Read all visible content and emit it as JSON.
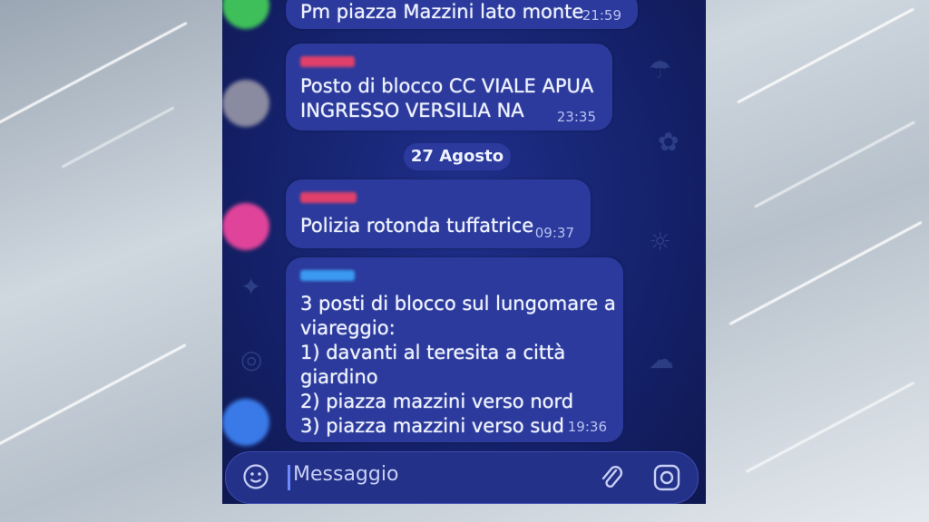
{
  "messages": [
    {
      "text": "Pm piazza Mazzini lato monte",
      "time": "21:59"
    },
    {
      "text": "Posto di blocco CC VIALE APUA\nINGRESSO VERSILIA NA",
      "time": "23:35"
    },
    {
      "text": "Polizia rotonda tuffatrice",
      "time": "09:37"
    },
    {
      "text": "3 posti di blocco sul lungomare a\nviareggio:\n1) davanti al teresita a città\ngiardino\n2) piazza mazzini verso nord\n3) piazza mazzini verso sud",
      "time": "19:36"
    }
  ],
  "date_separator": "27 Agosto",
  "input": {
    "placeholder": "Messaggio"
  },
  "colors": {
    "chat_background": "#15226c",
    "bubble": "#2b3a9c",
    "sender_name_pink": "#e0406a",
    "sender_name_blue": "#3a9af0",
    "avatar_green": "#3fbf5a",
    "avatar_gray": "#8a8aa0",
    "avatar_magenta": "#e0449a",
    "avatar_blue": "#3a7ae8"
  },
  "icons": [
    "emoji-icon",
    "attach-icon",
    "camera-icon"
  ]
}
